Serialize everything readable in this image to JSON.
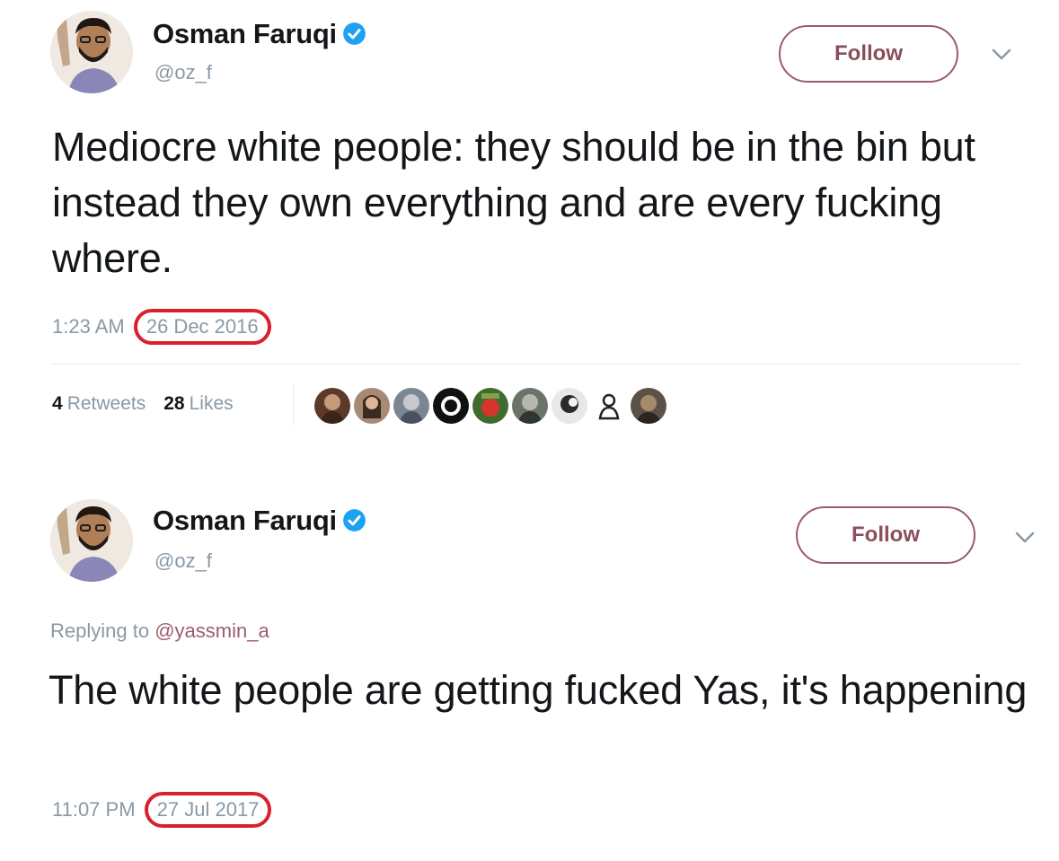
{
  "tweets": [
    {
      "author": {
        "name": "Osman Faruqi",
        "handle": "@oz_f"
      },
      "follow_label": "Follow",
      "text": "Mediocre white people: they should be in the bin but instead they own everything and are every fucking where.",
      "time": "1:23 AM",
      "date": "26 Dec 2016",
      "retweets": {
        "count": "4",
        "label": "Retweets"
      },
      "likes": {
        "count": "28",
        "label": "Likes"
      },
      "liker_avatars": [
        "avatar-1",
        "avatar-2",
        "avatar-3",
        "avatar-4",
        "avatar-5",
        "avatar-6",
        "avatar-7",
        "avatar-8",
        "avatar-9"
      ]
    },
    {
      "author": {
        "name": "Osman Faruqi",
        "handle": "@oz_f"
      },
      "follow_label": "Follow",
      "replying_prefix": "Replying to",
      "replying_to": "@yassmin_a",
      "text": "The white people are getting fucked Yas, it's happening",
      "time": "11:07 PM",
      "date": "27 Jul 2017"
    }
  ],
  "icons": {
    "verified": "verified-badge-icon",
    "more": "chevron-down-icon"
  },
  "colors": {
    "verified_blue": "#1da1f2",
    "follow_border": "#9a5a6a",
    "date_highlight": "#d9202b",
    "muted_text": "#8899a6"
  }
}
